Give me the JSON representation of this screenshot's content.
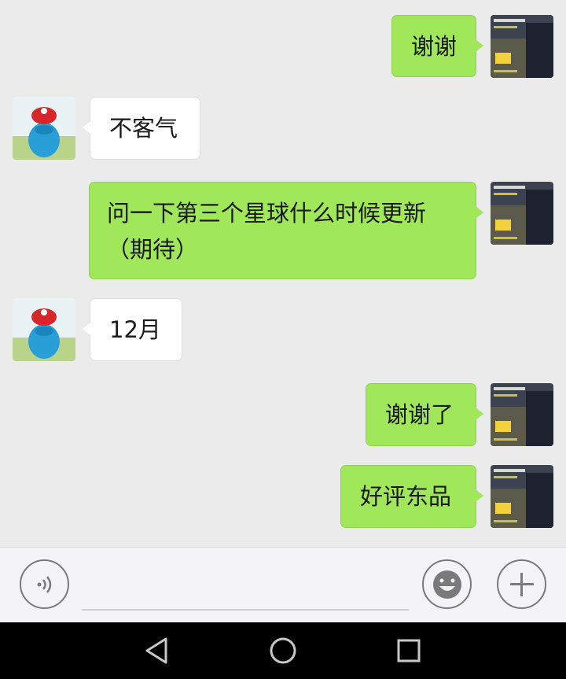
{
  "messages": [
    {
      "side": "me",
      "text": "谢谢"
    },
    {
      "side": "them",
      "text": "不客气"
    },
    {
      "side": "me",
      "text": "问一下第三个星球什么时候更新（期待）"
    },
    {
      "side": "them",
      "text": "12月"
    },
    {
      "side": "me",
      "text": "谢谢了"
    },
    {
      "side": "me",
      "text": "好评东品"
    }
  ],
  "icons": {
    "voice": "voice-icon",
    "emoji": "emoji-icon",
    "plus": "plus-icon",
    "nav_back": "back-triangle-icon",
    "nav_home": "home-circle-icon",
    "nav_recent": "recent-square-icon"
  },
  "colors": {
    "my_bubble": "#a0e75a",
    "their_bubble": "#ffffff",
    "chat_bg": "#ebebeb",
    "nav_bar": "#000000"
  }
}
